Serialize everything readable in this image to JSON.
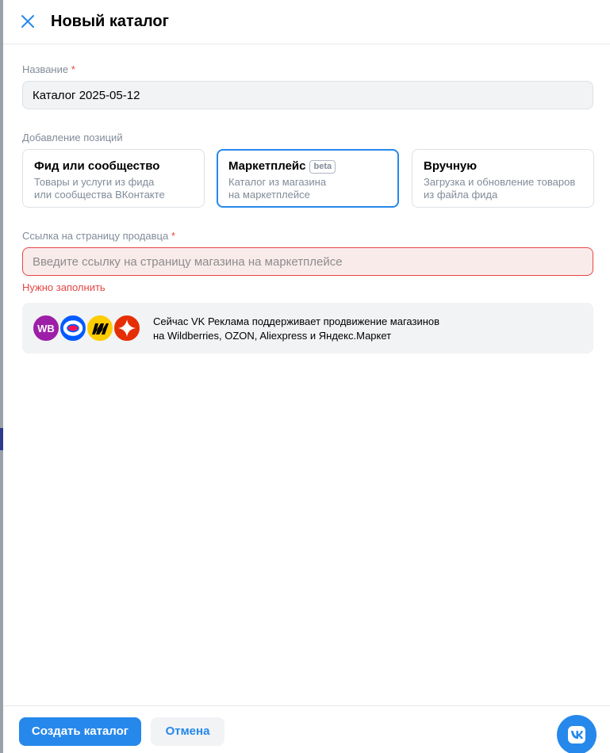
{
  "header": {
    "title": "Новый каталог"
  },
  "name_field": {
    "label": "Название",
    "required_mark": "*",
    "value": "Каталог 2025-05-12"
  },
  "positions": {
    "label": "Добавление позиций",
    "options": [
      {
        "title": "Фид или сообщество",
        "desc_line1": "Товары и услуги из фида",
        "desc_line2": "или сообщества ВКонтакте",
        "selected": false
      },
      {
        "title": "Маркетплейс",
        "badge": "beta",
        "desc_line1": "Каталог из магазина",
        "desc_line2": "на маркетплейсе",
        "selected": true
      },
      {
        "title": "Вручную",
        "desc_line1": "Загрузка и обновление товаров",
        "desc_line2": "из файла фида",
        "selected": false
      }
    ]
  },
  "seller_field": {
    "label": "Ссылка на страницу продавца",
    "required_mark": "*",
    "placeholder": "Введите ссылку на страницу магазина на маркетплейсе",
    "value": "",
    "error": "Нужно заполнить"
  },
  "info": {
    "line1": "Сейчас VK Реклама поддерживает продвижение магазинов",
    "line2": "на Wildberries, OZON, Aliexpress и Яндекс.Маркет",
    "logos": [
      {
        "name": "wildberries-logo",
        "text": "WB"
      },
      {
        "name": "ozon-logo"
      },
      {
        "name": "yandex-market-logo"
      },
      {
        "name": "aliexpress-logo"
      }
    ]
  },
  "footer": {
    "create_label": "Создать каталог",
    "cancel_label": "Отмена"
  },
  "colors": {
    "accent": "#2688eb",
    "error": "#e64646",
    "muted": "#818c99",
    "surface": "#f2f3f5"
  }
}
